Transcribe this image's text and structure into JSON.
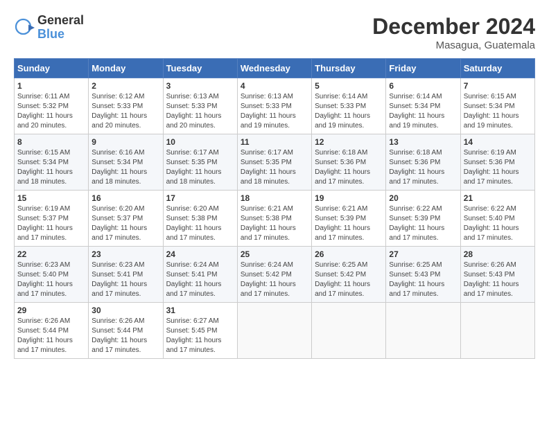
{
  "header": {
    "logo_general": "General",
    "logo_blue": "Blue",
    "month_title": "December 2024",
    "location": "Masagua, Guatemala"
  },
  "weekdays": [
    "Sunday",
    "Monday",
    "Tuesday",
    "Wednesday",
    "Thursday",
    "Friday",
    "Saturday"
  ],
  "weeks": [
    [
      {
        "day": "1",
        "info": "Sunrise: 6:11 AM\nSunset: 5:32 PM\nDaylight: 11 hours\nand 20 minutes."
      },
      {
        "day": "2",
        "info": "Sunrise: 6:12 AM\nSunset: 5:33 PM\nDaylight: 11 hours\nand 20 minutes."
      },
      {
        "day": "3",
        "info": "Sunrise: 6:13 AM\nSunset: 5:33 PM\nDaylight: 11 hours\nand 20 minutes."
      },
      {
        "day": "4",
        "info": "Sunrise: 6:13 AM\nSunset: 5:33 PM\nDaylight: 11 hours\nand 19 minutes."
      },
      {
        "day": "5",
        "info": "Sunrise: 6:14 AM\nSunset: 5:33 PM\nDaylight: 11 hours\nand 19 minutes."
      },
      {
        "day": "6",
        "info": "Sunrise: 6:14 AM\nSunset: 5:34 PM\nDaylight: 11 hours\nand 19 minutes."
      },
      {
        "day": "7",
        "info": "Sunrise: 6:15 AM\nSunset: 5:34 PM\nDaylight: 11 hours\nand 19 minutes."
      }
    ],
    [
      {
        "day": "8",
        "info": "Sunrise: 6:15 AM\nSunset: 5:34 PM\nDaylight: 11 hours\nand 18 minutes."
      },
      {
        "day": "9",
        "info": "Sunrise: 6:16 AM\nSunset: 5:34 PM\nDaylight: 11 hours\nand 18 minutes."
      },
      {
        "day": "10",
        "info": "Sunrise: 6:17 AM\nSunset: 5:35 PM\nDaylight: 11 hours\nand 18 minutes."
      },
      {
        "day": "11",
        "info": "Sunrise: 6:17 AM\nSunset: 5:35 PM\nDaylight: 11 hours\nand 18 minutes."
      },
      {
        "day": "12",
        "info": "Sunrise: 6:18 AM\nSunset: 5:36 PM\nDaylight: 11 hours\nand 17 minutes."
      },
      {
        "day": "13",
        "info": "Sunrise: 6:18 AM\nSunset: 5:36 PM\nDaylight: 11 hours\nand 17 minutes."
      },
      {
        "day": "14",
        "info": "Sunrise: 6:19 AM\nSunset: 5:36 PM\nDaylight: 11 hours\nand 17 minutes."
      }
    ],
    [
      {
        "day": "15",
        "info": "Sunrise: 6:19 AM\nSunset: 5:37 PM\nDaylight: 11 hours\nand 17 minutes."
      },
      {
        "day": "16",
        "info": "Sunrise: 6:20 AM\nSunset: 5:37 PM\nDaylight: 11 hours\nand 17 minutes."
      },
      {
        "day": "17",
        "info": "Sunrise: 6:20 AM\nSunset: 5:38 PM\nDaylight: 11 hours\nand 17 minutes."
      },
      {
        "day": "18",
        "info": "Sunrise: 6:21 AM\nSunset: 5:38 PM\nDaylight: 11 hours\nand 17 minutes."
      },
      {
        "day": "19",
        "info": "Sunrise: 6:21 AM\nSunset: 5:39 PM\nDaylight: 11 hours\nand 17 minutes."
      },
      {
        "day": "20",
        "info": "Sunrise: 6:22 AM\nSunset: 5:39 PM\nDaylight: 11 hours\nand 17 minutes."
      },
      {
        "day": "21",
        "info": "Sunrise: 6:22 AM\nSunset: 5:40 PM\nDaylight: 11 hours\nand 17 minutes."
      }
    ],
    [
      {
        "day": "22",
        "info": "Sunrise: 6:23 AM\nSunset: 5:40 PM\nDaylight: 11 hours\nand 17 minutes."
      },
      {
        "day": "23",
        "info": "Sunrise: 6:23 AM\nSunset: 5:41 PM\nDaylight: 11 hours\nand 17 minutes."
      },
      {
        "day": "24",
        "info": "Sunrise: 6:24 AM\nSunset: 5:41 PM\nDaylight: 11 hours\nand 17 minutes."
      },
      {
        "day": "25",
        "info": "Sunrise: 6:24 AM\nSunset: 5:42 PM\nDaylight: 11 hours\nand 17 minutes."
      },
      {
        "day": "26",
        "info": "Sunrise: 6:25 AM\nSunset: 5:42 PM\nDaylight: 11 hours\nand 17 minutes."
      },
      {
        "day": "27",
        "info": "Sunrise: 6:25 AM\nSunset: 5:43 PM\nDaylight: 11 hours\nand 17 minutes."
      },
      {
        "day": "28",
        "info": "Sunrise: 6:26 AM\nSunset: 5:43 PM\nDaylight: 11 hours\nand 17 minutes."
      }
    ],
    [
      {
        "day": "29",
        "info": "Sunrise: 6:26 AM\nSunset: 5:44 PM\nDaylight: 11 hours\nand 17 minutes."
      },
      {
        "day": "30",
        "info": "Sunrise: 6:26 AM\nSunset: 5:44 PM\nDaylight: 11 hours\nand 17 minutes."
      },
      {
        "day": "31",
        "info": "Sunrise: 6:27 AM\nSunset: 5:45 PM\nDaylight: 11 hours\nand 17 minutes."
      },
      {
        "day": "",
        "info": ""
      },
      {
        "day": "",
        "info": ""
      },
      {
        "day": "",
        "info": ""
      },
      {
        "day": "",
        "info": ""
      }
    ]
  ]
}
